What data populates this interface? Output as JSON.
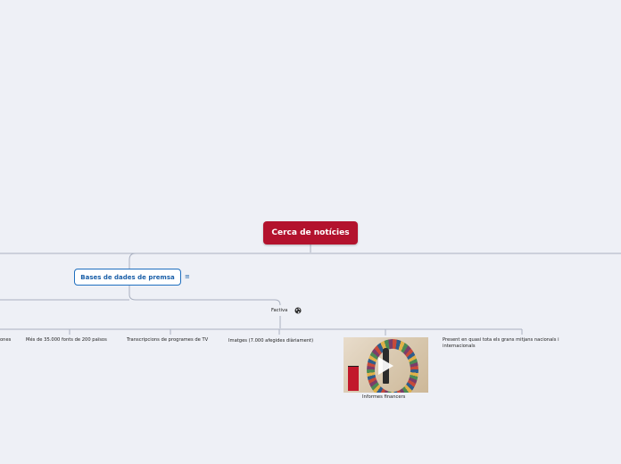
{
  "root": {
    "label": "Cerca de notícies"
  },
  "main_topic": {
    "label": "Bases de dades de premsa",
    "notes_icon": "notes-icon"
  },
  "subtopic": {
    "label": "Factiva",
    "link_icon": "globe-icon"
  },
  "leaves": [
    {
      "label": "ones"
    },
    {
      "label": "Més de 35.000 fonts de 200 països"
    },
    {
      "label": "Transcripcions de programes de TV"
    },
    {
      "label": "Imatges (7.000 afegides diàriament)"
    },
    {
      "label": "Informes financers",
      "media": "video-thumbnail",
      "media_icon": "play-icon"
    },
    {
      "label": "Present en quasi tota els grans mitjans nacionals i internacionals"
    }
  ],
  "colors": {
    "background": "#eef0f6",
    "root_fill": "#b3122d",
    "topic_border": "#1f6fbf",
    "topic_text": "#1a5fa8",
    "connector": "#a9b0c0"
  }
}
